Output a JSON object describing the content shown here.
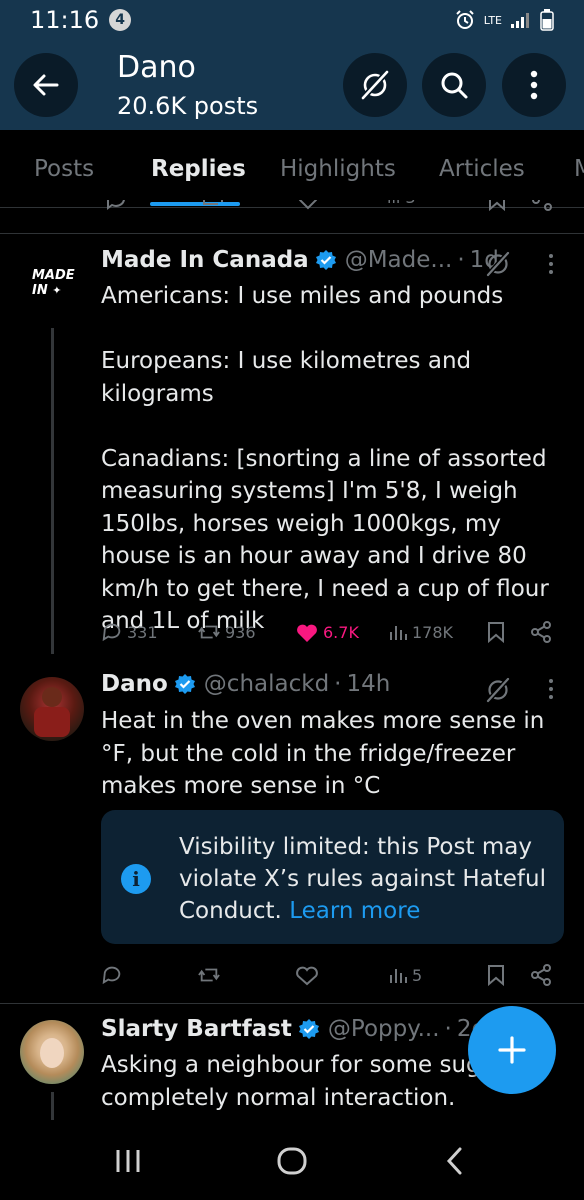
{
  "status_bar": {
    "time": "11:16",
    "notification_count": "4",
    "network_label": "LTE"
  },
  "header": {
    "title": "Dano",
    "subtitle": "20.6K posts"
  },
  "tabs": [
    {
      "label": "Posts",
      "active": false
    },
    {
      "label": "Replies",
      "active": true
    },
    {
      "label": "Highlights",
      "active": false
    },
    {
      "label": "Articles",
      "active": false
    }
  ],
  "partial_view_count": "3",
  "posts": [
    {
      "avatar_label_line1": "MADE",
      "avatar_label_line2": "IN",
      "name": "Made In Canada",
      "handle": "@Made...",
      "time": "1d",
      "text": "Americans: I use miles and pounds\n\nEuropeans: I use kilometres and kilograms\n\nCanadians: [snorting a line of assorted measuring systems] I'm 5'8, I weigh 150lbs, horses weigh 1000kgs, my house is an hour away and I drive 80 km/h to get there, I need a cup of flour and 1L of milk",
      "replies": "331",
      "reposts": "936",
      "likes": "6.7K",
      "views": "178K",
      "liked": true
    },
    {
      "name": "Dano",
      "handle": "@chalackd",
      "time": "14h",
      "text": "Heat in the oven makes more sense in °F, but the cold in the fridge/freezer makes more sense in °C",
      "notice": "Visibility limited: this Post may violate X’s rules against Hateful Conduct.",
      "notice_link": "Learn more",
      "replies": "",
      "reposts": "",
      "likes": "",
      "views": "5"
    },
    {
      "name": "Slarty Bartfast",
      "handle": "@Poppy...",
      "time": "2d",
      "text": "Asking a neighbour for some sugar is a completely normal interaction."
    }
  ],
  "colors": {
    "header_bg": "#16364e",
    "accent": "#1d9bf0",
    "like": "#f91880",
    "muted": "#71767b"
  }
}
